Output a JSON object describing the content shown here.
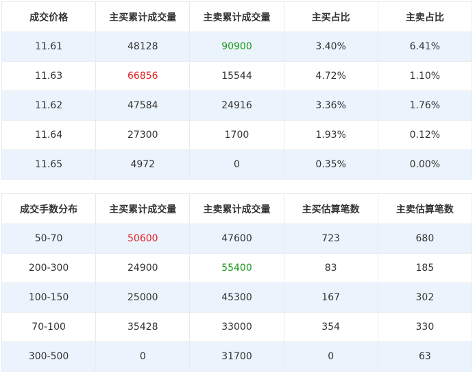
{
  "colors": {
    "up": "#e02020",
    "down": "#1a9a1a",
    "stripe": "#ebf3fc",
    "border": "#e6ebf1"
  },
  "price_table": {
    "headers": [
      "成交价格",
      "主买累计成交量",
      "主卖累计成交量",
      "主买占比",
      "主卖占比"
    ],
    "rows": [
      [
        "11.61",
        "48128",
        "90900",
        "3.40%",
        "6.41%"
      ],
      [
        "11.63",
        "66856",
        "15544",
        "4.72%",
        "1.10%"
      ],
      [
        "11.62",
        "47584",
        "24916",
        "3.36%",
        "1.76%"
      ],
      [
        "11.64",
        "27300",
        "1700",
        "1.93%",
        "0.12%"
      ],
      [
        "11.65",
        "4972",
        "0",
        "0.35%",
        "0.00%"
      ]
    ]
  },
  "lots_table": {
    "headers": [
      "成交手数分布",
      "主买累计成交量",
      "主卖累计成交量",
      "主买估算笔数",
      "主卖估算笔数"
    ],
    "rows": [
      [
        "50-70",
        "50600",
        "47600",
        "723",
        "680"
      ],
      [
        "200-300",
        "24900",
        "55400",
        "83",
        "185"
      ],
      [
        "100-150",
        "25000",
        "45300",
        "167",
        "302"
      ],
      [
        "70-100",
        "35428",
        "33000",
        "354",
        "330"
      ],
      [
        "300-500",
        "0",
        "31700",
        "0",
        "63"
      ]
    ]
  }
}
